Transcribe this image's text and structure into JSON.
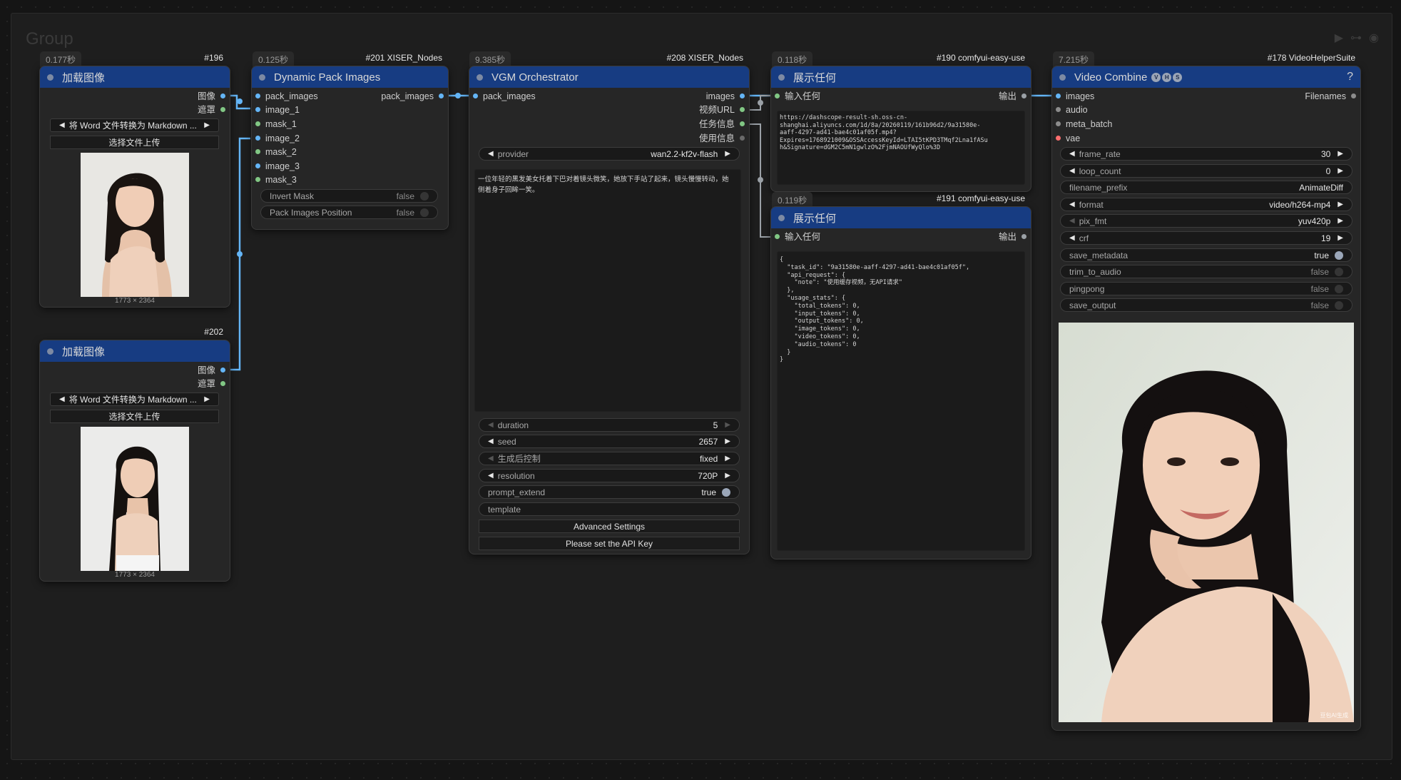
{
  "group": {
    "title": "Group",
    "controls": [
      "play-icon",
      "link-icon",
      "eye-icon"
    ]
  },
  "nodes": {
    "load1": {
      "time": "0.177秒",
      "id": "#196",
      "title": "加载图像",
      "outputs": [
        "图像",
        "遮罩"
      ],
      "file": "将 Word 文件转换为 Markdown ...",
      "upload": "选择文件上传",
      "dims": "1773 × 2364"
    },
    "load2": {
      "id": "#202",
      "title": "加载图像",
      "outputs": [
        "图像",
        "遮罩"
      ],
      "file": "将 Word 文件转换为 Markdown ...",
      "upload": "选择文件上传",
      "dims": "1773 × 2364"
    },
    "pack": {
      "time": "0.125秒",
      "id": "#201 XISER_Nodes",
      "title": "Dynamic Pack Images",
      "inputs": [
        "pack_images",
        "image_1",
        "mask_1",
        "image_2",
        "mask_2",
        "image_3",
        "mask_3"
      ],
      "output": "pack_images",
      "widgets": [
        {
          "label": "Invert Mask",
          "value": "false"
        },
        {
          "label": "Pack Images Position",
          "value": "false"
        }
      ]
    },
    "vgm": {
      "time": "9.385秒",
      "id": "#208 XISER_Nodes",
      "title": "VGM Orchestrator",
      "input": "pack_images",
      "outputs": [
        "images",
        "视频URL",
        "任务信息",
        "使用信息"
      ],
      "provider_label": "provider",
      "provider": "wan2.2-kf2v-flash",
      "prompt": "一位年轻的黑发美女托着下巴对着镜头微笑，她放下手站了起来，镜头慢慢转动，她\n侧着身子回眸一笑。",
      "widgets": [
        {
          "label": "duration",
          "value": "5"
        },
        {
          "label": "seed",
          "value": "2657"
        },
        {
          "label": "生成后控制",
          "value": "fixed"
        },
        {
          "label": "resolution",
          "value": "720P"
        },
        {
          "label": "prompt_extend",
          "value": "true"
        },
        {
          "label": "template",
          "value": ""
        }
      ],
      "buttons": [
        "Advanced Settings",
        "Please set the API Key"
      ]
    },
    "show1": {
      "time": "0.118秒",
      "id": "#190 comfyui-easy-use",
      "title": "展示任何",
      "input": "输入任何",
      "output": "输出",
      "text": "https://dashscope-result-sh.oss-cn-\nshanghai.aliyuncs.com/1d/8a/20260119/161b96d2/9a31580e-\naaff-4297-ad41-bae4c01af05f.mp4?\nExpires=1768921009&OSSAccessKeyId=LTAI5tKPD3TMqf2Lna1fASu\nh&Signature=dGM2C5mN1gwlzO%2FjmNAOUfWyQlo%3D"
    },
    "show2": {
      "time": "0.119秒",
      "id": "#191 comfyui-easy-use",
      "title": "展示任何",
      "input": "输入任何",
      "output": "输出",
      "text": "{\n  \"task_id\": \"9a31580e-aaff-4297-ad41-bae4c01af05f\",\n  \"api_request\": {\n    \"note\": \"使用缓存视频，无API请求\"\n  },\n  \"usage_stats\": {\n    \"total_tokens\": 0,\n    \"input_tokens\": 0,\n    \"output_tokens\": 0,\n    \"image_tokens\": 0,\n    \"video_tokens\": 0,\n    \"audio_tokens\": 0\n  }\n}"
    },
    "video": {
      "time": "7.215秒",
      "id": "#178 VideoHelperSuite",
      "title": "Video Combine",
      "badges": [
        "V",
        "H",
        "S"
      ],
      "help": "?",
      "inputs": [
        "images",
        "audio",
        "meta_batch",
        "vae"
      ],
      "output": "Filenames",
      "widgets": [
        {
          "label": "frame_rate",
          "value": "30"
        },
        {
          "label": "loop_count",
          "value": "0"
        },
        {
          "label": "filename_prefix",
          "value": "AnimateDiff"
        },
        {
          "label": "format",
          "value": "video/h264-mp4"
        },
        {
          "label": "pix_fmt",
          "value": "yuv420p"
        },
        {
          "label": "crf",
          "value": "19"
        },
        {
          "label": "save_metadata",
          "value": "true"
        },
        {
          "label": "trim_to_audio",
          "value": "false"
        },
        {
          "label": "pingpong",
          "value": "false"
        },
        {
          "label": "save_output",
          "value": "false"
        }
      ],
      "watermark": "豆包AI生成"
    }
  },
  "colors": {
    "header": "#173c82",
    "image_slot": "#64b5f6",
    "mask_slot": "#81c784",
    "any_slot": "#b0bec5",
    "vae_slot": "#ff6e6e",
    "link": "#64b5f6",
    "link_any": "#9aa0a6"
  }
}
